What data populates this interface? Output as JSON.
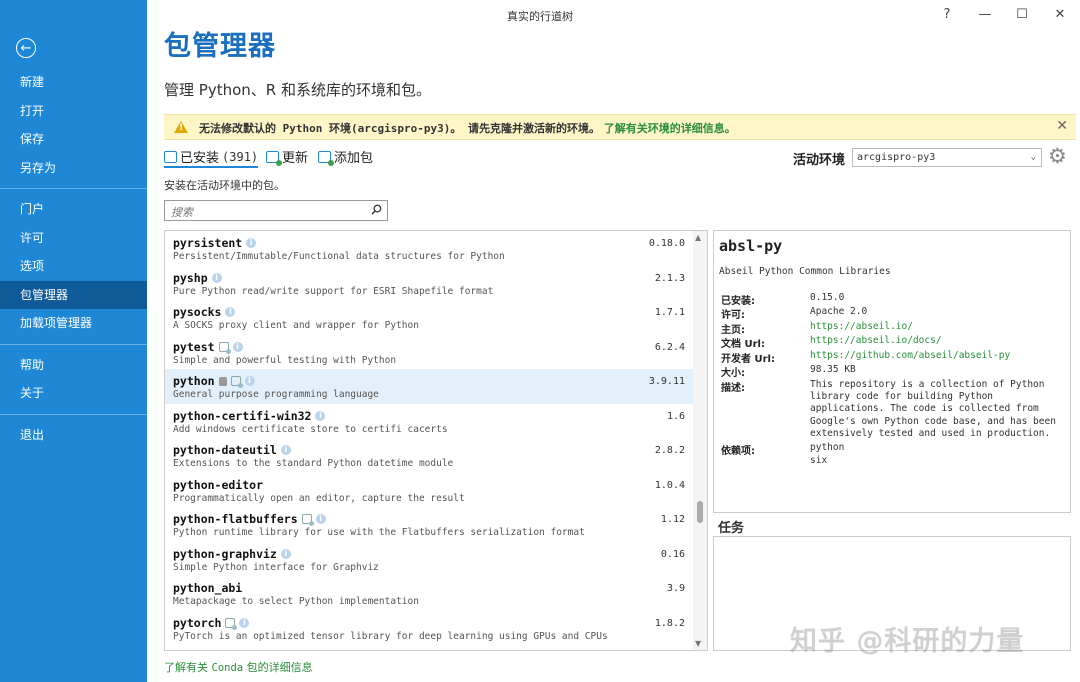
{
  "window": {
    "title": "真实的行道树",
    "help": "?",
    "minimize": "—",
    "maximize": "☐",
    "close": "✕"
  },
  "sidebar": {
    "back": "←",
    "items": [
      {
        "label": "新建"
      },
      {
        "label": "打开"
      },
      {
        "label": "保存"
      },
      {
        "label": "另存为"
      },
      {
        "label": "门户"
      },
      {
        "label": "许可"
      },
      {
        "label": "选项"
      },
      {
        "label": "包管理器"
      },
      {
        "label": "加载项管理器"
      },
      {
        "label": "帮助"
      },
      {
        "label": "关于"
      },
      {
        "label": "退出"
      }
    ]
  },
  "header": {
    "title": "包管理器",
    "subtitle": "管理 Python、R 和系统库的环境和包。"
  },
  "warning": {
    "text": "无法修改默认的 Python 环境(arcgispro-py3)。 请先克隆并激活新的环境。",
    "link": "了解有关环境的详细信息。",
    "close": "✕"
  },
  "tabs": {
    "installed": "已安装",
    "installed_count": "(391)",
    "update": "更新",
    "add": "添加包"
  },
  "environment": {
    "label": "活动环境",
    "value": "arcgispro-py3"
  },
  "installed_note": "安装在活动环境中的包。",
  "search": {
    "placeholder": "搜索"
  },
  "packages": [
    {
      "name": "pyrsistent",
      "desc": "Persistent/Immutable/Functional data structures for Python",
      "version": "0.18.0",
      "icons": [
        "info"
      ]
    },
    {
      "name": "pyshp",
      "desc": "Pure Python read/write support for ESRI Shapefile format",
      "version": "2.1.3",
      "icons": [
        "info"
      ]
    },
    {
      "name": "pysocks",
      "desc": "A SOCKS proxy client and wrapper for Python",
      "version": "1.7.1",
      "icons": [
        "info"
      ]
    },
    {
      "name": "pytest",
      "desc": "Simple and powerful testing with Python",
      "version": "6.2.4",
      "icons": [
        "update",
        "info"
      ]
    },
    {
      "name": "python",
      "desc": "General purpose programming language",
      "version": "3.9.11",
      "icons": [
        "lock",
        "update",
        "info"
      ],
      "selected": true
    },
    {
      "name": "python-certifi-win32",
      "desc": "Add windows certificate store to certifi cacerts",
      "version": "1.6",
      "icons": [
        "info"
      ]
    },
    {
      "name": "python-dateutil",
      "desc": "Extensions to the standard Python datetime module",
      "version": "2.8.2",
      "icons": [
        "info"
      ]
    },
    {
      "name": "python-editor",
      "desc": "Programmatically open an editor, capture the result",
      "version": "1.0.4",
      "icons": []
    },
    {
      "name": "python-flatbuffers",
      "desc": "Python runtime library for use with the Flatbuffers serialization format",
      "version": "1.12",
      "icons": [
        "update",
        "info"
      ]
    },
    {
      "name": "python-graphviz",
      "desc": "Simple Python interface for Graphviz",
      "version": "0.16",
      "icons": [
        "info"
      ]
    },
    {
      "name": "python_abi",
      "desc": "Metapackage to select Python implementation",
      "version": "3.9",
      "icons": []
    },
    {
      "name": "pytorch",
      "desc": "PyTorch is an optimized tensor library for deep learning using GPUs and CPUs",
      "version": "1.8.2",
      "icons": [
        "update",
        "info"
      ]
    }
  ],
  "detail": {
    "title": "absl-py",
    "summary": "Abseil Python Common Libraries",
    "installed_label": "已安装:",
    "installed": "0.15.0",
    "license_label": "许可:",
    "license": "Apache 2.0",
    "home_label": "主页:",
    "home": "https://abseil.io/",
    "docs_label": "文档 Url:",
    "docs": "https://abseil.io/docs/",
    "dev_label": "开发者 Url:",
    "dev": "https://github.com/abseil/abseil-py",
    "size_label": "大小:",
    "size": "98.35 KB",
    "desc_label": "描述:",
    "desc": "This repository is a collection of Python library code for building Python applications. The code is collected from Google's own Python code base, and has been extensively tested and used in production.",
    "deps_label": "依赖项:",
    "deps": [
      "python",
      "six"
    ]
  },
  "tasks": {
    "label": "任务"
  },
  "footer": {
    "pre": "了解有关 ",
    "mono": "Conda",
    "post": " 包的详细信息"
  },
  "watermark": "知乎 @科研的力量"
}
